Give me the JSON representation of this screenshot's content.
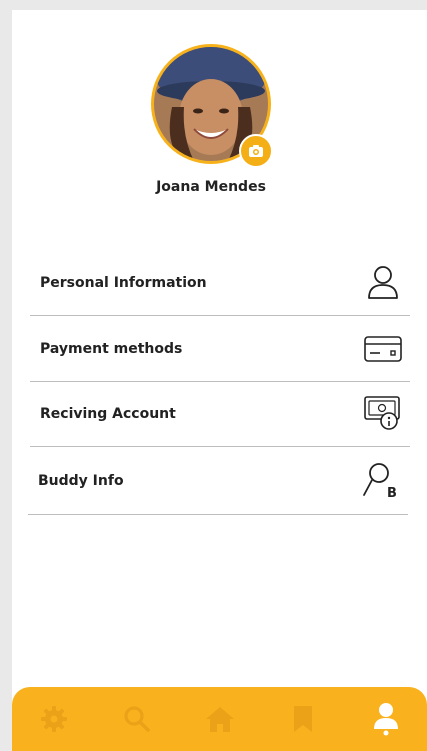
{
  "profile": {
    "name": "Joana Mendes"
  },
  "menu": [
    {
      "label": "Personal Information",
      "icon": "user-icon"
    },
    {
      "label": "Payment methods",
      "icon": "credit-card-icon"
    },
    {
      "label": "Reciving Account",
      "icon": "money-account-icon"
    },
    {
      "label": "Buddy Info",
      "icon": "buddy-icon",
      "badge": "B"
    }
  ],
  "tabbar": {
    "items": [
      "settings-icon",
      "search-icon",
      "home-icon",
      "bookmark-icon",
      "profile-icon"
    ],
    "active": "profile-icon"
  },
  "colors": {
    "accent": "#f9b21d",
    "tab_inactive": "#eba118",
    "tab_active": "#ffffff"
  }
}
